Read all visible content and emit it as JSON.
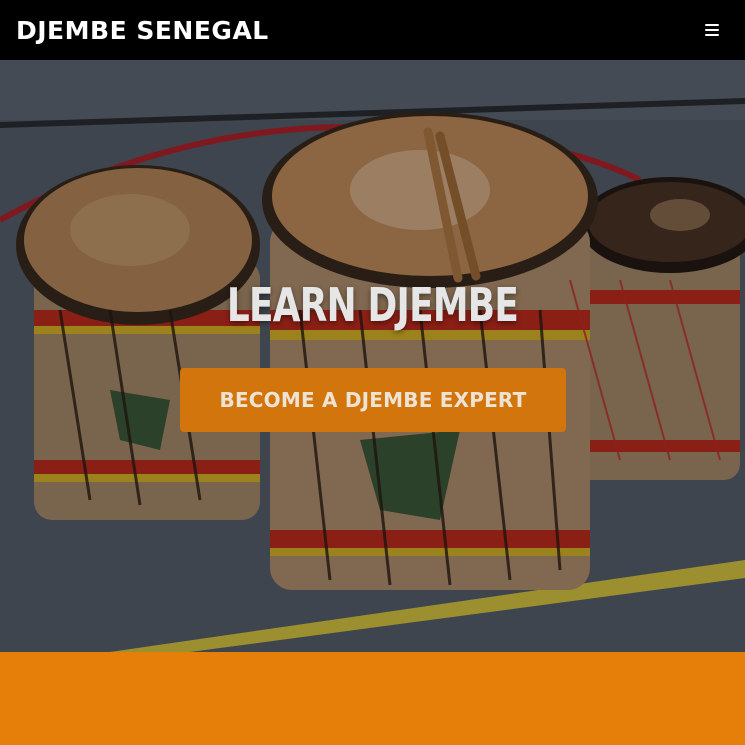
{
  "navbar": {
    "brand": "DJEMBE SENEGAL",
    "menu_icon": "hamburger-menu-icon"
  },
  "hero": {
    "image": "djembe-drums-photo",
    "title": "LEARN DJEMBE",
    "cta_label": "BECOME A DJEMBE EXPERT"
  },
  "colors": {
    "navbar_bg": "#000000",
    "accent": "#d2750d",
    "band": "#e67e0a"
  }
}
